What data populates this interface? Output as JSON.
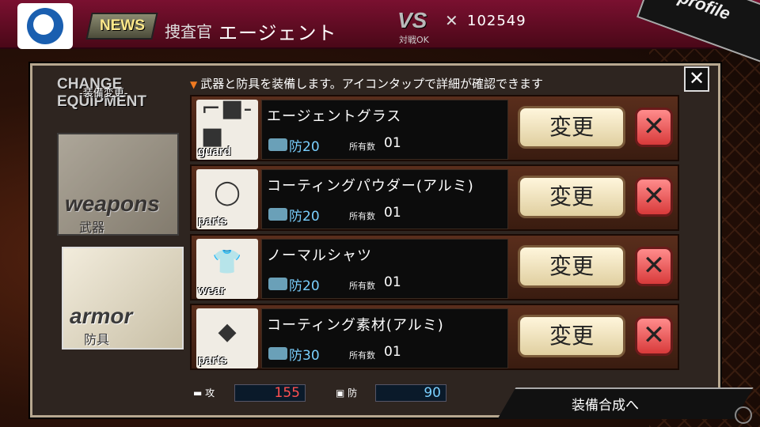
{
  "header": {
    "news_label": "NEWS",
    "rank": "捜査官",
    "agent_name": "エージェント",
    "vs_label": "VS",
    "vs_sub": "対戦OK",
    "points": "102549",
    "profile_label": "profile"
  },
  "sidebar": {
    "title_en": "CHANGE\nEQUIPMENT",
    "title_jp": "-装備変更-",
    "weapons": {
      "en": "weapons",
      "jp": "武器"
    },
    "armor": {
      "en": "armor",
      "jp": "防具"
    }
  },
  "instruction": "武器と防具を装備します。アイコンタップで詳細が確認できます",
  "items": [
    {
      "name": "エージェントグラス",
      "category": "guard",
      "defense": "防20",
      "own_label": "所有数",
      "own": "01",
      "change": "変更",
      "icon": "sunglasses-icon"
    },
    {
      "name": "コーティングパウダー(アルミ)",
      "category": "parts",
      "defense": "防20",
      "own_label": "所有数",
      "own": "01",
      "change": "変更",
      "icon": "powder-bowl-icon"
    },
    {
      "name": "ノーマルシャツ",
      "category": "wear",
      "defense": "防20",
      "own_label": "所有数",
      "own": "01",
      "change": "変更",
      "icon": "shirt-icon"
    },
    {
      "name": "コーティング素材(アルミ)",
      "category": "parts",
      "defense": "防30",
      "own_label": "所有数",
      "own": "01",
      "change": "変更",
      "icon": "metal-chunk-icon"
    }
  ],
  "stats": {
    "attack_label": "攻",
    "attack": "155",
    "defense_label": "防",
    "defense": "90"
  },
  "synth_label": "装備合成へ",
  "colors": {
    "accent_red": "#7a1030",
    "defense_blue": "#7ad0ff",
    "attack_red": "#ff5050"
  }
}
